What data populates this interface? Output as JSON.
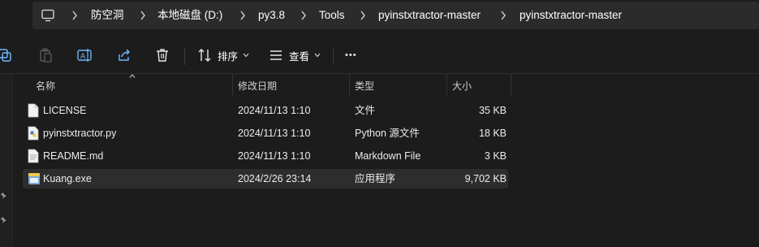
{
  "address": {
    "breadcrumbs": [
      "防空洞",
      "本地磁盘 (D:)",
      "py3.8",
      "Tools",
      "pyinstxtractor-master",
      "pyinstxtractor-master"
    ]
  },
  "toolbar": {
    "sort_label": "排序",
    "view_label": "查看",
    "more_label": "•••"
  },
  "columns": {
    "name": "名称",
    "modified": "修改日期",
    "type": "类型",
    "size": "大小"
  },
  "files": [
    {
      "name": "LICENSE",
      "modified": "2024/11/13 1:10",
      "type": "文件",
      "size": "35 KB",
      "icon": "document-icon"
    },
    {
      "name": "pyinstxtractor.py",
      "modified": "2024/11/13 1:10",
      "type": "Python 源文件",
      "size": "18 KB",
      "icon": "python-file-icon"
    },
    {
      "name": "README.md",
      "modified": "2024/11/13 1:10",
      "type": "Markdown File",
      "size": "3 KB",
      "icon": "markdown-file-icon"
    },
    {
      "name": "Kuang.exe",
      "modified": "2024/2/26 23:14",
      "type": "应用程序",
      "size": "9,702 KB",
      "icon": "exe-icon",
      "selected": true
    }
  ],
  "colors": {
    "background": "#1c1c1c",
    "selected_row": "#2d2d2d",
    "address_box": "#2b2b2b"
  }
}
